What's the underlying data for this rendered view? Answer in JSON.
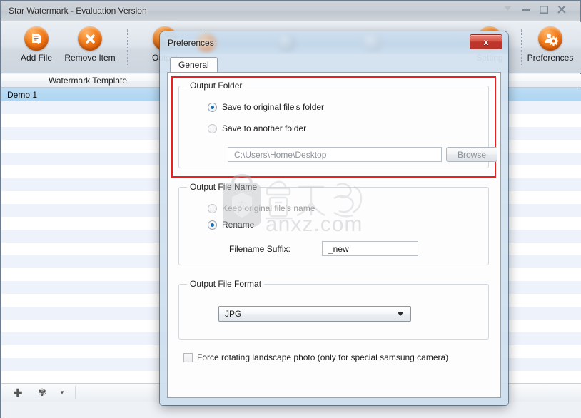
{
  "main_window": {
    "title": "Star Watermark - Evaluation Version",
    "window_controls": [
      {
        "name": "dropdown",
        "glyph": "▾"
      },
      {
        "name": "minimize",
        "glyph": "—"
      },
      {
        "name": "maximize",
        "glyph": "□"
      },
      {
        "name": "close",
        "glyph": "✕"
      }
    ],
    "toolbar": [
      {
        "label": "Add File",
        "icon": "add-file-icon",
        "glyph": "🗎"
      },
      {
        "label": "Remove Item",
        "icon": "remove-item-icon",
        "glyph": "✕"
      },
      {
        "label": "Output",
        "icon": "output-icon",
        "glyph": "▶"
      },
      {
        "label": "Setting",
        "icon": "setting-icon",
        "glyph": "⚙"
      },
      {
        "label": "Preferences",
        "icon": "preferences-icon",
        "glyph": "⚙"
      }
    ],
    "list": {
      "column_header": "Watermark Template",
      "rows": [
        {
          "label": "Demo 1",
          "selected": true
        },
        {
          "label": "",
          "selected": false
        },
        {
          "label": "",
          "selected": false
        },
        {
          "label": "",
          "selected": false
        },
        {
          "label": "",
          "selected": false
        },
        {
          "label": "",
          "selected": false
        },
        {
          "label": "",
          "selected": false
        },
        {
          "label": "",
          "selected": false
        },
        {
          "label": "",
          "selected": false
        },
        {
          "label": "",
          "selected": false
        },
        {
          "label": "",
          "selected": false
        },
        {
          "label": "",
          "selected": false
        },
        {
          "label": "",
          "selected": false
        },
        {
          "label": "",
          "selected": false
        },
        {
          "label": "",
          "selected": false
        },
        {
          "label": "",
          "selected": false
        },
        {
          "label": "",
          "selected": false
        },
        {
          "label": "",
          "selected": false
        },
        {
          "label": "",
          "selected": false
        },
        {
          "label": "",
          "selected": false
        },
        {
          "label": "",
          "selected": false
        },
        {
          "label": "",
          "selected": false
        },
        {
          "label": "",
          "selected": false
        }
      ]
    },
    "bottom_bar": {
      "add": "✚",
      "gear": "✾",
      "arrow": "▾"
    }
  },
  "dialog": {
    "title": "Preferences",
    "close_label": "x",
    "tabs": [
      {
        "label": "General",
        "active": true
      }
    ],
    "output_folder": {
      "group_title": "Output Folder",
      "option_original": "Save to original file's folder",
      "option_another": "Save to another folder",
      "selected": "original",
      "path_value": "C:\\Users\\Home\\Desktop",
      "browse_label": "Browse"
    },
    "output_file_name": {
      "group_title": "Output File Name",
      "option_keep": "Keep original file's name",
      "option_rename": "Rename",
      "selected": "rename",
      "suffix_label": "Filename Suffix:",
      "suffix_value": "_new"
    },
    "output_file_format": {
      "group_title": "Output File Format",
      "selected": "JPG",
      "options": [
        "JPG"
      ]
    },
    "force_rotate": {
      "label": "Force rotating landscape photo (only for special samsung camera)",
      "checked": false
    }
  },
  "watermark": {
    "text": "anxz.com"
  },
  "colors": {
    "accent_orange": "#f58220",
    "highlight_red": "#ef1d1d",
    "selection_blue": "#b3d8f2",
    "row_alt_blue": "#eef2fb"
  }
}
